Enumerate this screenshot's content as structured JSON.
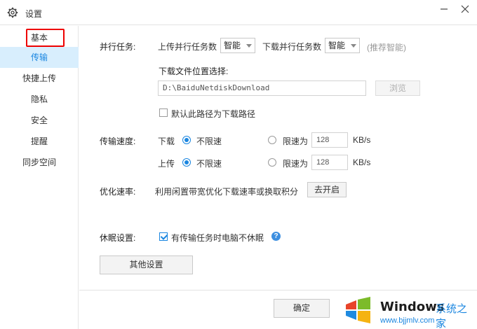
{
  "window": {
    "title": "设置"
  },
  "sidebar": {
    "items": [
      {
        "label": "基本"
      },
      {
        "label": "传输"
      },
      {
        "label": "快捷上传"
      },
      {
        "label": "隐私"
      },
      {
        "label": "安全"
      },
      {
        "label": "提醒"
      },
      {
        "label": "同步空间"
      }
    ],
    "active_index": 1
  },
  "parallel": {
    "section_label": "并行任务:",
    "upload_label": "上传并行任务数",
    "upload_value": "智能",
    "download_label": "下载并行任务数",
    "download_value": "智能",
    "hint": "(推荐智能)"
  },
  "download_location": {
    "label": "下载文件位置选择:",
    "path": "D:\\BaiduNetdiskDownload",
    "browse_label": "浏览",
    "default_checkbox_label": "默认此路径为下载路径",
    "default_checked": false
  },
  "speed": {
    "section_label": "传输速度:",
    "download": {
      "label": "下载",
      "unlimited_label": "不限速",
      "limit_label": "限速为",
      "limit_value": "128",
      "unit": "KB/s",
      "unlimited_selected": true
    },
    "upload": {
      "label": "上传",
      "unlimited_label": "不限速",
      "limit_label": "限速为",
      "limit_value": "128",
      "unit": "KB/s",
      "unlimited_selected": true
    }
  },
  "optimize": {
    "section_label": "优化速率:",
    "description": "利用闲置带宽优化下载速率或换取积分",
    "button_label": "去开启"
  },
  "sleep": {
    "section_label": "休眠设置:",
    "checkbox_label": "有传输任务时电脑不休眠",
    "checked": true
  },
  "other_settings_label": "其他设置",
  "footer": {
    "ok_label": "确定"
  },
  "watermark": {
    "brand": "Windows",
    "brand_cn": "系统之家",
    "url": "www.bjjmlv.com"
  },
  "colors": {
    "accent": "#1a86e0",
    "active_bg": "#d8eefd",
    "highlight_box": "#e00000"
  }
}
